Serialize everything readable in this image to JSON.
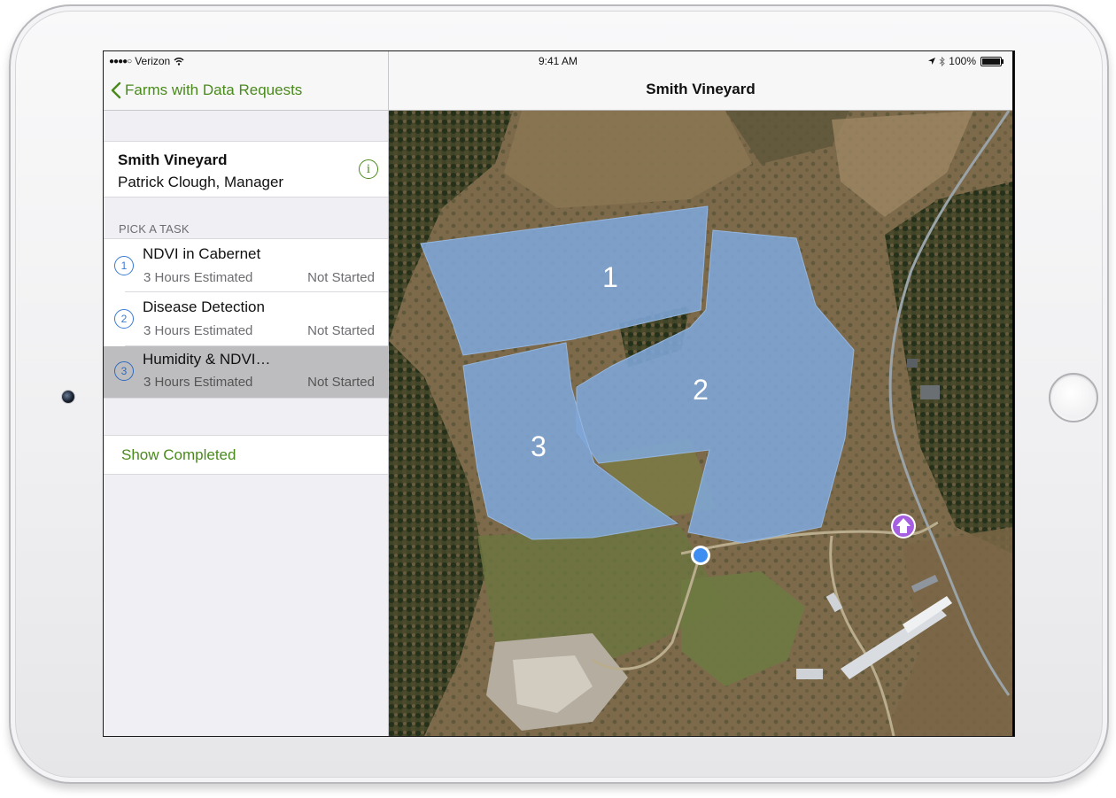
{
  "status_bar": {
    "carrier": "Verizon",
    "signal": "●●●●○",
    "time": "9:41 AM",
    "battery": "100%"
  },
  "master": {
    "back_label": "Farms with Data Requests",
    "farm": {
      "name": "Smith Vineyard",
      "manager": "Patrick Clough, Manager"
    },
    "section_header": "PICK A TASK",
    "tasks": [
      {
        "number": "1",
        "title": "NDVI in Cabernet",
        "estimate": "3 Hours Estimated",
        "status": "Not Started",
        "selected": false
      },
      {
        "number": "2",
        "title": "Disease Detection",
        "estimate": "3 Hours Estimated",
        "status": "Not Started",
        "selected": false
      },
      {
        "number": "3",
        "title": "Humidity & NDVI…",
        "estimate": "3 Hours Estimated",
        "status": "Not Started",
        "selected": true
      }
    ],
    "show_completed": "Show Completed"
  },
  "detail": {
    "title": "Smith Vineyard",
    "map": {
      "field_labels": [
        "1",
        "2",
        "3"
      ],
      "field_color": "#7ea6d8",
      "location_dot_color": "#3d8ef0",
      "marker_color": "#a65fe0"
    }
  },
  "colors": {
    "accent_green": "#4a8a1c",
    "task_number_blue": "#3a7bd5",
    "selected_row": "#bdbdbf"
  },
  "icons": {
    "back": "chevron-left-icon",
    "info": "info-icon",
    "location": "location-arrow-icon",
    "bluetooth": "bluetooth-icon",
    "wifi": "wifi-icon",
    "battery": "battery-icon",
    "marker": "upload-arrow-icon"
  }
}
